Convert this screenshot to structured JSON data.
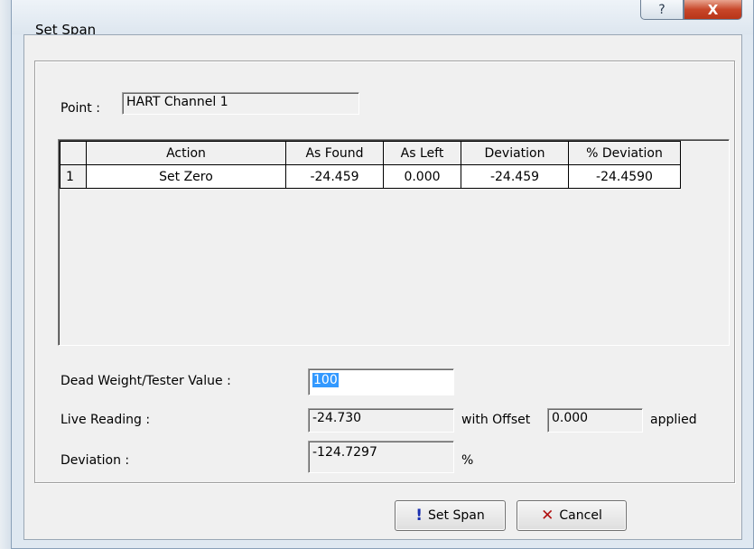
{
  "window": {
    "title": "Set Span",
    "help_glyph": "?",
    "close_glyph": "X"
  },
  "point": {
    "label": "Point :",
    "value": "HART Channel 1"
  },
  "table": {
    "columns": [
      "",
      "Action",
      "As Found",
      "As Left",
      "Deviation",
      "% Deviation"
    ],
    "rows": [
      {
        "no": "1",
        "action": "Set Zero",
        "as_found": "-24.459",
        "as_left": "0.000",
        "deviation": "-24.459",
        "pct_deviation": "-24.4590"
      }
    ]
  },
  "form": {
    "dead_weight_label": "Dead Weight/Tester Value :",
    "dead_weight_value": "100",
    "live_reading_label": "Live Reading :",
    "live_reading_value": "-24.730",
    "with_offset_label": "with Offset",
    "offset_value": "0.000",
    "applied_label": "applied",
    "deviation_label": "Deviation :",
    "deviation_value": "-124.7297",
    "percent_label": "%"
  },
  "buttons": {
    "set_span_icon": "!",
    "set_span": "Set Span",
    "cancel_icon": "✕",
    "cancel": "Cancel"
  },
  "colors": {
    "selection": "#3399ff",
    "close_red": "#c8472a",
    "dialog_bg": "#f0f0f0"
  }
}
